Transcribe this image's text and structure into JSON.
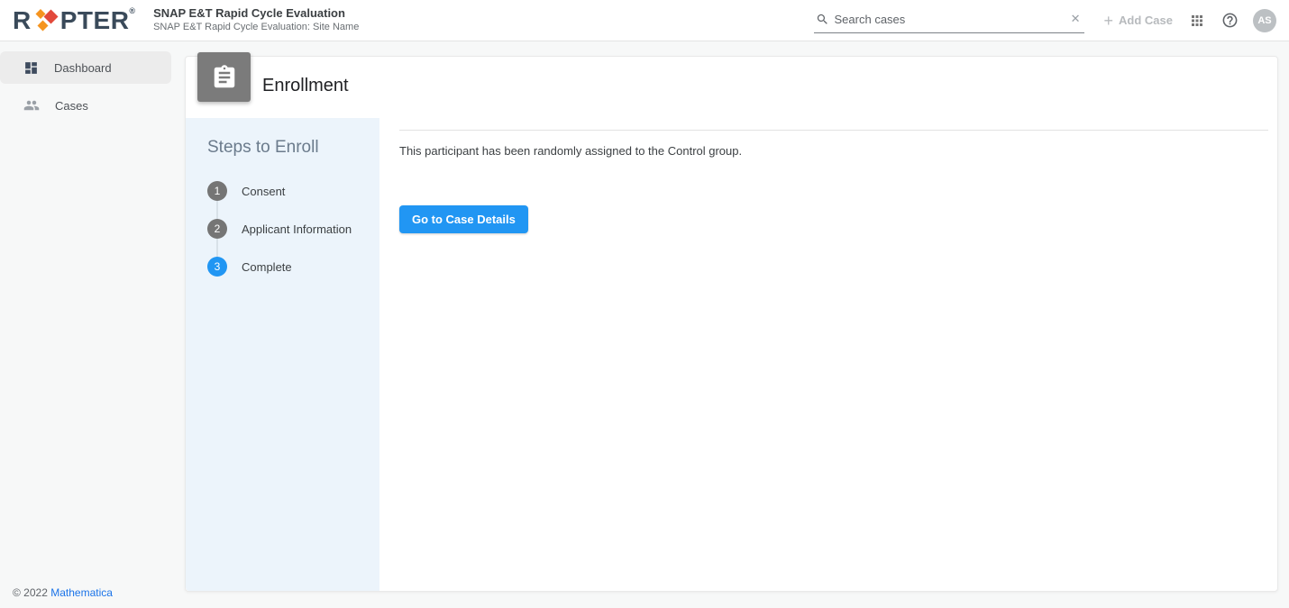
{
  "brand": {
    "logo_prefix": "R",
    "logo_suffix": "PTER",
    "registered_mark": "®",
    "colors": {
      "navy": "#3A4A5A",
      "diamond_orange": "#F5941F",
      "diamond_red": "#E2493B",
      "accent_blue": "#2196F3",
      "steps_panel_blue": "#ECF4FB",
      "link_blue": "#1A73E8"
    }
  },
  "header": {
    "app_title": "SNAP E&T Rapid Cycle Evaluation",
    "app_subtitle": "SNAP E&T Rapid Cycle Evaluation: Site Name",
    "search": {
      "placeholder": "Search cases",
      "value": "",
      "clear_glyph": "✕"
    },
    "add_case": {
      "label": "Add Case",
      "plus_glyph": "+",
      "enabled": false
    },
    "avatar_initials": "AS"
  },
  "sidebar": {
    "items": [
      {
        "label": "Dashboard",
        "icon": "dashboard-icon",
        "active": true
      },
      {
        "label": "Cases",
        "icon": "people-icon",
        "active": false
      }
    ],
    "footer": {
      "copyright": "© 2022",
      "link_label": "Mathematica"
    }
  },
  "main": {
    "page_title": "Enrollment",
    "page_icon": "clipboard-icon",
    "steps_panel": {
      "heading": "Steps to Enroll",
      "steps": [
        {
          "number": "1",
          "label": "Consent",
          "state": "default"
        },
        {
          "number": "2",
          "label": "Applicant Information",
          "state": "default"
        },
        {
          "number": "3",
          "label": "Complete",
          "state": "active"
        }
      ]
    },
    "content": {
      "message": "This participant has been randomly assigned to the Control group.",
      "button_label": "Go to Case Details"
    }
  }
}
